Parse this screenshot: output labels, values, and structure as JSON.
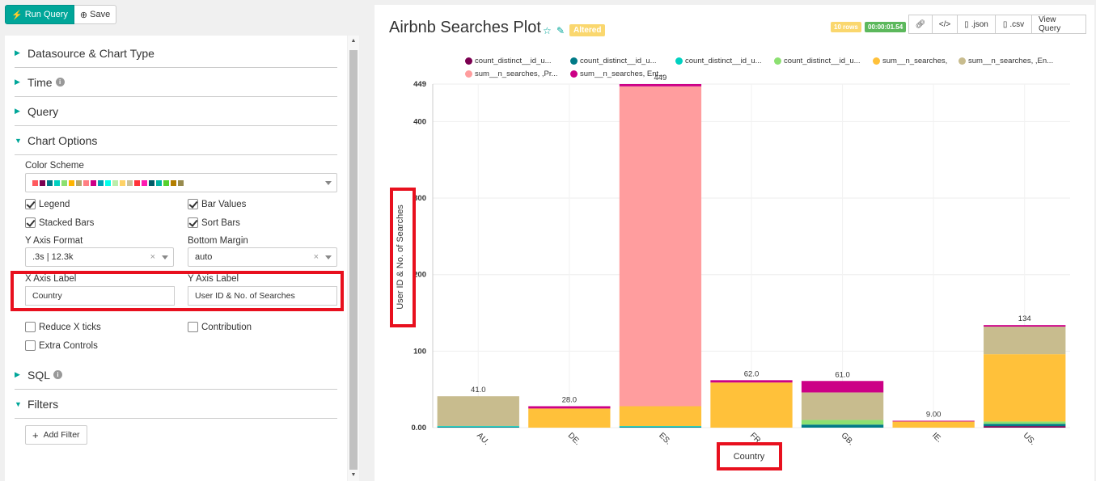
{
  "toolbar": {
    "run_label": "Run Query",
    "save_label": "Save"
  },
  "sections": {
    "datasource": "Datasource & Chart Type",
    "time": "Time",
    "query": "Query",
    "chart_options": "Chart Options",
    "sql": "SQL",
    "filters": "Filters"
  },
  "chart_options": {
    "color_scheme_label": "Color Scheme",
    "color_scheme_swatches": [
      "#ff5a5f",
      "#7b0051",
      "#007a87",
      "#00d1c1",
      "#8ce071",
      "#ffb400",
      "#b4a76c",
      "#ff8083",
      "#cc0086",
      "#00a1b3",
      "#00ffeb",
      "#bbedab",
      "#ffd266",
      "#cbc29a",
      "#ff3339",
      "#ff1ab1",
      "#005c66",
      "#00b3a5",
      "#55d12e",
      "#b37e00",
      "#988b4e"
    ],
    "legend_label": "Legend",
    "legend_checked": true,
    "bar_values_label": "Bar Values",
    "bar_values_checked": true,
    "stacked_bars_label": "Stacked Bars",
    "stacked_bars_checked": true,
    "sort_bars_label": "Sort Bars",
    "sort_bars_checked": true,
    "y_axis_format_label": "Y Axis Format",
    "y_axis_format_value": ".3s | 12.3k",
    "bottom_margin_label": "Bottom Margin",
    "bottom_margin_value": "auto",
    "x_axis_label_label": "X Axis Label",
    "x_axis_label_value": "Country",
    "y_axis_label_label": "Y Axis Label",
    "y_axis_label_value": "User ID & No. of Searches",
    "reduce_x_ticks_label": "Reduce X ticks",
    "reduce_x_ticks_checked": false,
    "contribution_label": "Contribution",
    "contribution_checked": false,
    "extra_controls_label": "Extra Controls",
    "extra_controls_checked": false
  },
  "filters": {
    "add_filter_label": "Add Filter"
  },
  "chart_header": {
    "title": "Airbnb Searches Plot",
    "altered_label": "Altered",
    "rows_badge": "10 rows",
    "time_badge": "00:00:01.54",
    "json_label": ".json",
    "csv_label": ".csv",
    "view_query_label": "View Query"
  },
  "chart_data": {
    "type": "bar",
    "stacked": true,
    "categories": [
      "AU.",
      "DE.",
      "ES.",
      "FR",
      "GB.",
      "IE.",
      "US."
    ],
    "xlabel": "Country",
    "ylabel": "User ID & No. of Searches",
    "ylim": [
      0,
      449
    ],
    "yticks": [
      "0.00",
      "100",
      "200",
      "300",
      "400",
      "449"
    ],
    "bar_totals": [
      "41.0",
      "28.0",
      "449",
      "62.0",
      "61.0",
      "9.00",
      "134"
    ],
    "series": [
      {
        "name": "count_distinct__id_u...",
        "color": "#7b0051",
        "values": [
          0,
          0,
          0,
          0,
          0,
          0,
          2
        ]
      },
      {
        "name": "count_distinct__id_u...",
        "color": "#007a87",
        "values": [
          1,
          0,
          1,
          0,
          4,
          0,
          3
        ]
      },
      {
        "name": "count_distinct__id_u...",
        "color": "#00d1c1",
        "values": [
          1,
          0,
          1,
          0,
          0,
          0,
          0
        ]
      },
      {
        "name": "count_distinct__id_u...",
        "color": "#8ce071",
        "values": [
          0,
          0,
          0,
          0,
          6,
          0,
          3
        ]
      },
      {
        "name": "sum__n_searches,",
        "color": "#ffc13a",
        "values": [
          0,
          25,
          26,
          59,
          0,
          8,
          88
        ]
      },
      {
        "name": "sum__n_searches, ,En...",
        "color": "#c8bc8e",
        "values": [
          39,
          0,
          0,
          0,
          36,
          0,
          36
        ]
      },
      {
        "name": "sum__n_searches, ,Pr...",
        "color": "#ff9d9e",
        "values": [
          0,
          0,
          418,
          0,
          0,
          0,
          0
        ]
      },
      {
        "name": "sum__n_searches, Ent...",
        "color": "#cc0086",
        "values": [
          0,
          3,
          3,
          3,
          15,
          1,
          2
        ]
      }
    ]
  }
}
